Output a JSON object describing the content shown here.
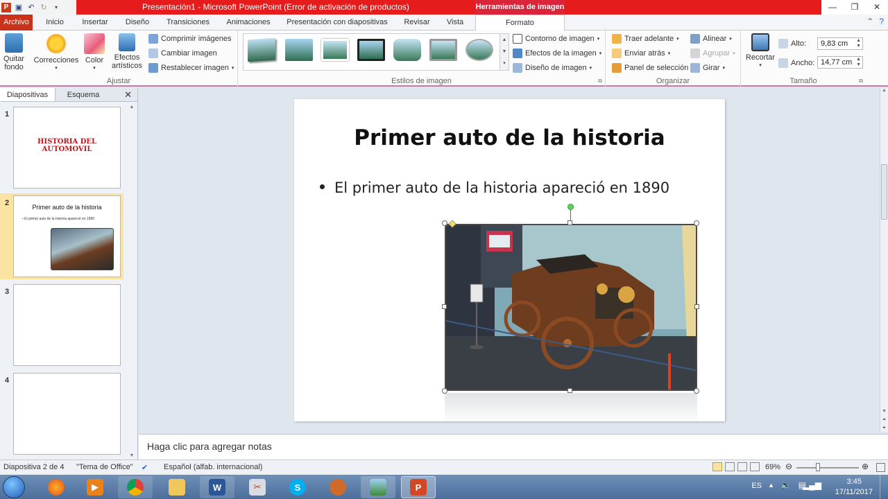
{
  "window": {
    "title": "Presentación1  -  Microsoft PowerPoint (Error de activación de productos)",
    "context_tab": "Herramientas de imagen",
    "controls": [
      "—",
      "❐",
      "✕"
    ]
  },
  "tabs": {
    "file": "Archivo",
    "items": [
      "Inicio",
      "Insertar",
      "Diseño",
      "Transiciones",
      "Animaciones",
      "Presentación con diapositivas",
      "Revisar",
      "Vista"
    ],
    "active": "Formato"
  },
  "ribbon": {
    "ajustar": {
      "label": "Ajustar",
      "quitar_fondo": [
        "Quitar",
        "fondo"
      ],
      "correcciones": "Correcciones",
      "color": "Color",
      "efectos": [
        "Efectos",
        "artísticos"
      ],
      "comprimir": "Comprimir imágenes",
      "cambiar": "Cambiar imagen",
      "restablecer": "Restablecer imagen"
    },
    "estilos": {
      "label": "Estilos de imagen",
      "contorno": "Contorno de imagen",
      "efectos": "Efectos de la imagen",
      "diseno": "Diseño de imagen"
    },
    "organizar": {
      "label": "Organizar",
      "traer": "Traer adelante",
      "enviar": "Enviar atrás",
      "panel": "Panel de selección",
      "alinear": "Alinear",
      "agrupar": "Agrupar",
      "girar": "Girar"
    },
    "tamano": {
      "label": "Tamaño",
      "recortar": "Recortar",
      "alto_label": "Alto:",
      "alto": "9,83 cm",
      "ancho_label": "Ancho:",
      "ancho": "14,77 cm"
    }
  },
  "left_pane": {
    "tab_slides": "Diapositivas",
    "tab_outline": "Esquema",
    "close": "✕",
    "slides": [
      {
        "num": "1",
        "title": "HISTORIA DEL AUTOMOVIL"
      },
      {
        "num": "2",
        "title": "Primer auto  de la historia",
        "bullet": "El primer auto de la historia apareció en 1890"
      },
      {
        "num": "3"
      },
      {
        "num": "4"
      }
    ]
  },
  "slide": {
    "title": "Primer auto de la historia",
    "bullet": "El primer auto de la historia apareció en 1890"
  },
  "notes": {
    "placeholder": "Haga clic para agregar notas"
  },
  "status": {
    "slide_info": "Diapositiva 2 de 4",
    "theme": "\"Tema de Office\"",
    "language": "Español (alfab. internacional)",
    "zoom": "69%"
  },
  "taskbar": {
    "lang": "ES",
    "time": "3:45",
    "date": "17/11/2017"
  }
}
